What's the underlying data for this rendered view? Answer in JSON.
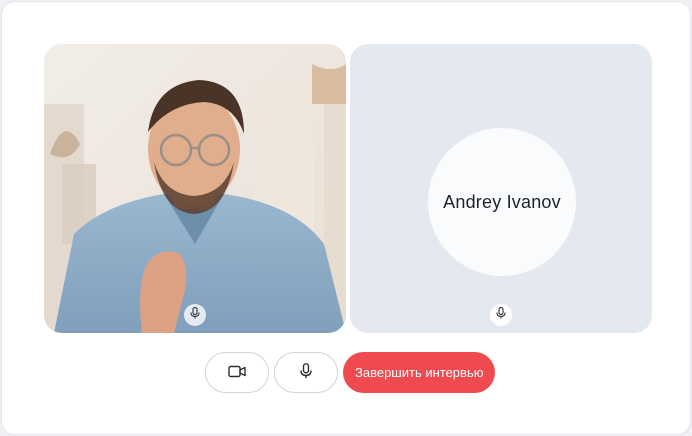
{
  "call": {
    "self_tile": {
      "video": "person-with-glasses-video",
      "mic_icon": "microphone-icon"
    },
    "remote_tile": {
      "participant_name": "Andrey Ivanov",
      "mic_icon": "microphone-icon"
    }
  },
  "controls": {
    "camera_icon": "video-camera-icon",
    "mic_icon": "microphone-icon",
    "end_label": "Завершить интервью"
  },
  "colors": {
    "end_button": "#ef4a4f",
    "remote_tile_bg": "#e4e9f0",
    "card_bg": "#ffffff"
  }
}
